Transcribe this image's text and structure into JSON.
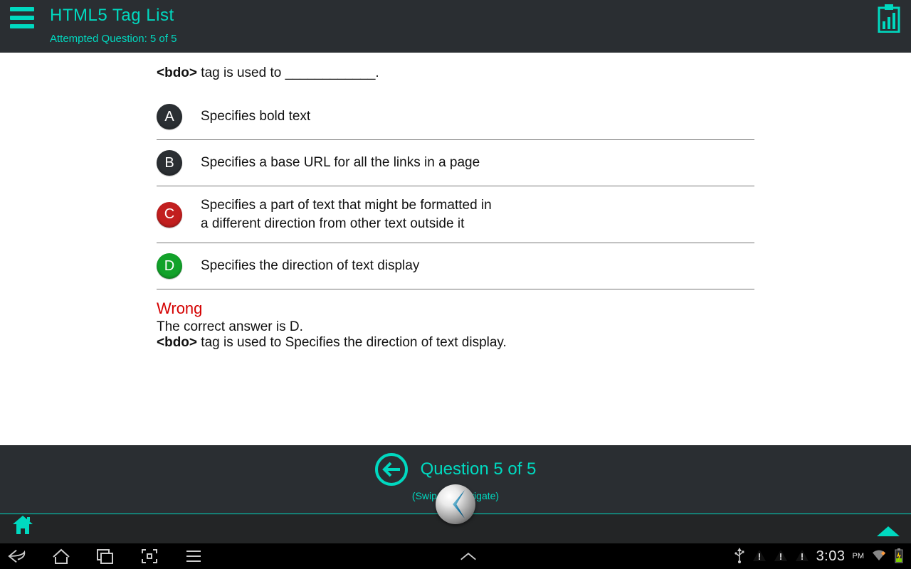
{
  "header": {
    "title": "HTML5 Tag List",
    "attempt_line": "Attempted Question: 5 of 5"
  },
  "question": {
    "tag_bold": "<bdo>",
    "stem_rest": " tag is used to ____________.",
    "options": [
      {
        "letter": "A",
        "text": "Specifies bold text",
        "state": "default"
      },
      {
        "letter": "B",
        "text": "Specifies a base URL for all the links in a page",
        "state": "default"
      },
      {
        "letter": "C",
        "text": "Specifies a part of text that might be formatted in\na different direction from other text outside it",
        "state": "wrong"
      },
      {
        "letter": "D",
        "text": "Specifies the direction of text display",
        "state": "correct"
      }
    ]
  },
  "feedback": {
    "status": "Wrong",
    "line1": "The correct answer is D.",
    "tag_bold": "<bdo>",
    "line2_rest": " tag is used to Specifies the direction of text display."
  },
  "footer": {
    "counter": "Question 5 of  5",
    "swipe_hint": "(Swipe to Navigate)"
  },
  "system": {
    "time": "3:03",
    "ampm": "PM"
  }
}
